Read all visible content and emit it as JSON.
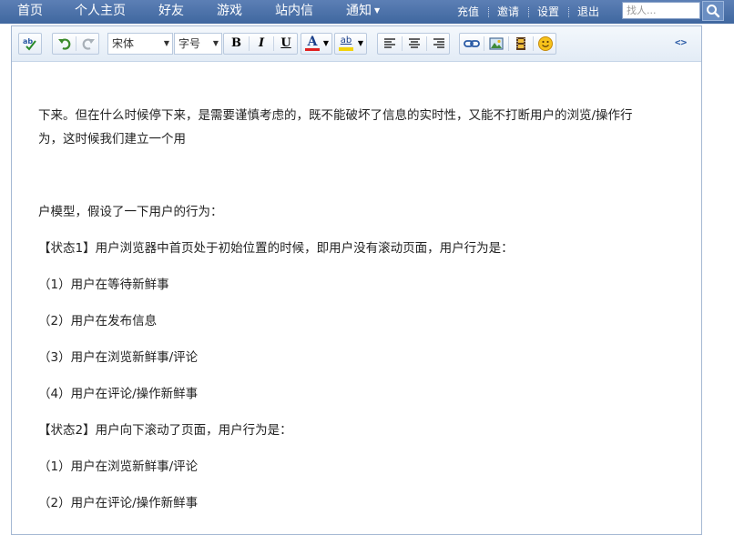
{
  "nav": {
    "items": [
      "首页",
      "个人主页",
      "好友",
      "游戏",
      "站内信",
      "通知"
    ],
    "right": [
      "充值",
      "邀请",
      "设置",
      "退出"
    ],
    "search_placeholder": "找人..."
  },
  "toolbar": {
    "font_family": "宋体",
    "font_size": "字号",
    "bold": "B",
    "italic": "I",
    "underline": "U",
    "color": "A",
    "highlight": "ab",
    "source": "<>"
  },
  "content": {
    "lines": [
      "下来。但在什么时候停下来，是需要谨慎考虑的，既不能破坏了信息的实时性，又能不打断用户的浏览/操作行",
      "为，这时候我们建立一个用",
      "户模型，假设了一下用户的行为：",
      "【状态1】用户浏览器中首页处于初始位置的时候，即用户没有滚动页面，用户行为是：",
      "（1）用户在等待新鲜事",
      "（2）用户在发布信息",
      "（3）用户在浏览新鲜事/评论",
      "（4）用户在评论/操作新鲜事",
      "【状态2】用户向下滚动了页面，用户行为是：",
      "（1）用户在浏览新鲜事/评论",
      "（2）用户在评论/操作新鲜事"
    ]
  },
  "colors": {
    "nav_bg": "#3f679f",
    "toolbar_bg": "#e3ecf6",
    "text_color_underline": "#e02020",
    "highlight_underline": "#f2d20a"
  },
  "icons": [
    "spellcheck-icon",
    "undo-icon",
    "redo-icon",
    "align-left-icon",
    "align-center-icon",
    "align-right-icon",
    "link-icon",
    "image-icon",
    "video-icon",
    "emoticon-icon",
    "source-code-icon",
    "search-icon"
  ]
}
